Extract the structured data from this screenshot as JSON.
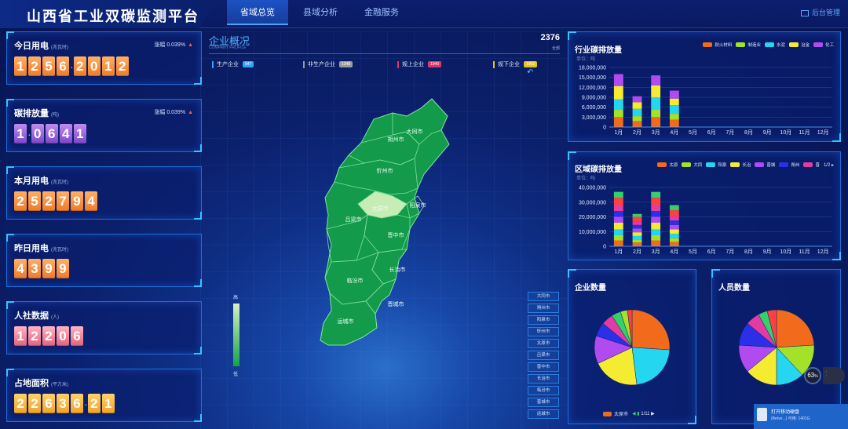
{
  "header": {
    "title": "山西省工业双碳监测平台",
    "tabs": [
      {
        "label": "省域总览",
        "active": true
      },
      {
        "label": "县域分析",
        "active": false
      },
      {
        "label": "金融服务",
        "active": false
      }
    ],
    "backend_label": "后台管理"
  },
  "kpis": [
    {
      "title": "今日用电",
      "unit": "(兆瓦时)",
      "change_label": "涨幅",
      "change_value": "0.039%",
      "digits": [
        "1",
        "2",
        "5",
        "6",
        ".",
        "2",
        "0",
        "1",
        "2"
      ],
      "color": "orange"
    },
    {
      "title": "碳排放量",
      "unit": "(吨)",
      "change_label": "涨幅",
      "change_value": "0.039%",
      "digits": [
        "1",
        ".",
        "0",
        "6",
        "4",
        "1"
      ],
      "color": "purple"
    },
    {
      "title": "本月用电",
      "unit": "(兆瓦时)",
      "change_label": "",
      "change_value": "",
      "digits": [
        "2",
        "5",
        "2",
        "7",
        "9",
        "4"
      ],
      "color": "orange"
    },
    {
      "title": "昨日用电",
      "unit": "(兆瓦时)",
      "change_label": "",
      "change_value": "",
      "digits": [
        "4",
        "3",
        "9",
        "9"
      ],
      "color": "orange"
    },
    {
      "title": "人社数据",
      "unit": "(人)",
      "change_label": "",
      "change_value": "",
      "digits": [
        "1",
        "2",
        "2",
        "0",
        "6"
      ],
      "color": "pink"
    },
    {
      "title": "占地面积",
      "unit": "(平方米)",
      "change_label": "",
      "change_value": "",
      "digits": [
        "2",
        "2",
        "6",
        "3",
        "6",
        ".",
        "2",
        "1"
      ],
      "color": "yellow"
    }
  ],
  "overview": {
    "title": "企业概况",
    "subtitle": "COMPANY PROFILE",
    "total": "2376",
    "total_label": "全部",
    "categories": [
      {
        "label": "生产企业",
        "count": "947",
        "color": "#2aa8ff"
      },
      {
        "label": "非生产企业",
        "count": "1248",
        "color": "#9b9b9b"
      },
      {
        "label": "规上企业",
        "count": "1040",
        "color": "#e0356c"
      },
      {
        "label": "规下企业",
        "count": "1002",
        "color": "#e6c21f"
      }
    ],
    "map_labels": [
      "大同市",
      "朔州市",
      "忻州市",
      "太原市",
      "阳泉市",
      "吕梁市",
      "晋中市",
      "长治市",
      "临汾市",
      "晋城市",
      "运城市"
    ],
    "legend_high": "高",
    "legend_low": "低",
    "city_buttons": [
      "大同市",
      "朔州市",
      "阳泉市",
      "忻州市",
      "太原市",
      "吕梁市",
      "晋中市",
      "长治市",
      "临汾市",
      "晋城市",
      "运城市"
    ]
  },
  "industry_panel": {
    "title": "行业碳排放量",
    "unit": "单位：吨",
    "legend": [
      {
        "name": "耐火材料",
        "color": "#f26b1d"
      },
      {
        "name": "制造业",
        "color": "#a4e22a"
      },
      {
        "name": "水泥",
        "color": "#25d6f0"
      },
      {
        "name": "冶金",
        "color": "#f5ec32"
      },
      {
        "name": "化工",
        "color": "#b14bf0"
      }
    ]
  },
  "region_panel": {
    "title": "区域碳排放量",
    "unit": "单位：吨",
    "legend": [
      {
        "name": "太原",
        "color": "#f26b1d"
      },
      {
        "name": "大同",
        "color": "#a4e22a"
      },
      {
        "name": "阳泉",
        "color": "#25d6f0"
      },
      {
        "name": "长治",
        "color": "#f5ec32"
      },
      {
        "name": "晋城",
        "color": "#b14bf0"
      },
      {
        "name": "朔州",
        "color": "#2b2fe6"
      },
      {
        "name": "晋",
        "color": "#e23ba1"
      }
    ],
    "pager": "1/2"
  },
  "company_panel": {
    "title": "企业数量",
    "foot_label": "太原市",
    "pager": "1/11"
  },
  "staff_panel": {
    "title": "人员数量"
  },
  "gauge": {
    "value": "63",
    "unit": "%"
  },
  "notice": {
    "title": "打开移动硬盘",
    "subtitle": "(Betve...)   可用: 1401G"
  },
  "chart_data": [
    {
      "type": "bar",
      "title": "行业碳排放量",
      "ylabel": "单位：吨",
      "categories": [
        "1月",
        "2月",
        "3月",
        "4月",
        "5月",
        "6月",
        "7月",
        "8月",
        "9月",
        "10月",
        "11月",
        "12月"
      ],
      "ylim": [
        0,
        18000000
      ],
      "yticks": [
        "0",
        "3,000,000",
        "6,000,000",
        "9,000,000",
        "12,000,000",
        "15,000,000",
        "18,000,000"
      ],
      "stacked": true,
      "series": [
        {
          "name": "耐火材料",
          "values": [
            3000000,
            1800000,
            3000000,
            2200000,
            0,
            0,
            0,
            0,
            0,
            0,
            0,
            0
          ]
        },
        {
          "name": "制造业",
          "values": [
            2200000,
            1500000,
            2400000,
            1800000,
            0,
            0,
            0,
            0,
            0,
            0,
            0,
            0
          ]
        },
        {
          "name": "水泥",
          "values": [
            3200000,
            2200000,
            3600000,
            2600000,
            0,
            0,
            0,
            0,
            0,
            0,
            0,
            0
          ]
        },
        {
          "name": "冶金",
          "values": [
            4000000,
            2000000,
            3600000,
            2000000,
            0,
            0,
            0,
            0,
            0,
            0,
            0,
            0
          ]
        },
        {
          "name": "化工",
          "values": [
            3600000,
            1800000,
            3000000,
            2400000,
            0,
            0,
            0,
            0,
            0,
            0,
            0,
            0
          ]
        }
      ]
    },
    {
      "type": "bar",
      "title": "区域碳排放量",
      "ylabel": "单位：吨",
      "categories": [
        "1月",
        "2月",
        "3月",
        "4月",
        "5月",
        "6月",
        "7月",
        "8月",
        "9月",
        "10月",
        "11月",
        "12月"
      ],
      "ylim": [
        0,
        40000000
      ],
      "yticks": [
        "0",
        "10,000,000",
        "20,000,000",
        "30,000,000",
        "40,000,000"
      ],
      "stacked": true,
      "series": [
        {
          "name": "太原",
          "values": [
            4000000,
            2500000,
            4000000,
            3000000,
            0,
            0,
            0,
            0,
            0,
            0,
            0,
            0
          ]
        },
        {
          "name": "大同",
          "values": [
            3500000,
            2000000,
            3500000,
            2500000,
            0,
            0,
            0,
            0,
            0,
            0,
            0,
            0
          ]
        },
        {
          "name": "阳泉",
          "values": [
            4000000,
            2500000,
            4000000,
            3000000,
            0,
            0,
            0,
            0,
            0,
            0,
            0,
            0
          ]
        },
        {
          "name": "长治",
          "values": [
            4500000,
            2500000,
            4500000,
            3000000,
            0,
            0,
            0,
            0,
            0,
            0,
            0,
            0
          ]
        },
        {
          "name": "晋城",
          "values": [
            4000000,
            2500000,
            4000000,
            3000000,
            0,
            0,
            0,
            0,
            0,
            0,
            0,
            0
          ]
        },
        {
          "name": "朔州",
          "values": [
            4000000,
            2500000,
            4000000,
            3000000,
            0,
            0,
            0,
            0,
            0,
            0,
            0,
            0
          ]
        },
        {
          "name": "晋",
          "values": [
            4000000,
            2500000,
            4000000,
            3000000,
            0,
            0,
            0,
            0,
            0,
            0,
            0,
            0
          ]
        },
        {
          "name": "",
          "values": [
            5000000,
            3000000,
            5000000,
            4000000,
            0,
            0,
            0,
            0,
            0,
            0,
            0,
            0
          ]
        },
        {
          "name": "",
          "values": [
            4000000,
            2000000,
            4000000,
            3500000,
            0,
            0,
            0,
            0,
            0,
            0,
            0,
            0
          ]
        }
      ],
      "extra_colors": [
        "#ff4040",
        "#35d06a"
      ]
    },
    {
      "type": "pie",
      "title": "企业数量",
      "slices": [
        {
          "value": 26,
          "color": "#f26b1d"
        },
        {
          "value": 22,
          "color": "#25d6f0"
        },
        {
          "value": 20,
          "color": "#f5ec32"
        },
        {
          "value": 12,
          "color": "#b14bf0"
        },
        {
          "value": 6,
          "color": "#2b2fe6"
        },
        {
          "value": 5,
          "color": "#e23ba1"
        },
        {
          "value": 4,
          "color": "#35d06a"
        },
        {
          "value": 3,
          "color": "#a4e22a"
        },
        {
          "value": 2,
          "color": "#ff4040"
        }
      ]
    },
    {
      "type": "pie",
      "title": "人员数量",
      "slices": [
        {
          "value": 24,
          "color": "#f26b1d"
        },
        {
          "value": 14,
          "color": "#a4e22a"
        },
        {
          "value": 12,
          "color": "#25d6f0"
        },
        {
          "value": 14,
          "color": "#f5ec32"
        },
        {
          "value": 12,
          "color": "#b14bf0"
        },
        {
          "value": 10,
          "color": "#2b2fe6"
        },
        {
          "value": 6,
          "color": "#e23ba1"
        },
        {
          "value": 4,
          "color": "#35d06a"
        },
        {
          "value": 4,
          "color": "#ff4040"
        }
      ]
    }
  ]
}
